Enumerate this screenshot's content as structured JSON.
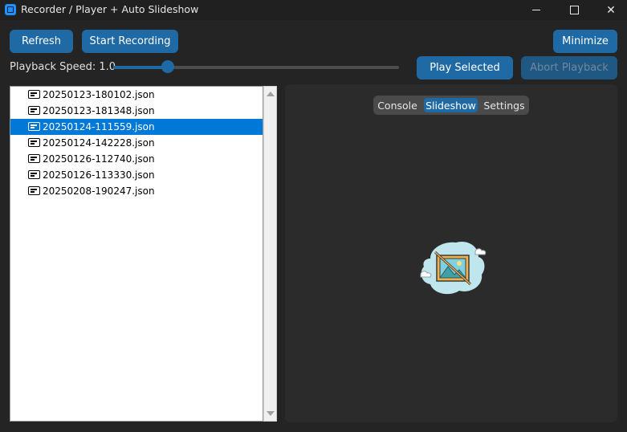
{
  "window": {
    "title": "Recorder / Player + Auto Slideshow",
    "minimize_glyph": "",
    "maximize_glyph": "",
    "close_glyph": "✕"
  },
  "toolbar": {
    "refresh_label": "Refresh",
    "start_recording_label": "Start Recording",
    "minimize_label": "Minimize",
    "play_selected_label": "Play Selected",
    "abort_playback_label": "Abort Playback",
    "abort_playback_disabled": true
  },
  "playback": {
    "speed_label": "Playback Speed: 1.0",
    "speed_value": 1.0,
    "slider_fraction": 0.19
  },
  "files": {
    "items": [
      "20250123-180102.json",
      "20250123-181348.json",
      "20250124-111559.json",
      "20250124-142228.json",
      "20250126-112740.json",
      "20250126-113330.json",
      "20250208-190247.json"
    ],
    "selected_index": 2
  },
  "tabs": {
    "console_label": "Console",
    "slideshow_label": "Slideshow",
    "settings_label": "Settings",
    "active": "Slideshow"
  },
  "slideshow": {
    "placeholder_icon": "no-image-icon"
  },
  "colors": {
    "accent": "#1f6aa5",
    "selection": "#0078d7",
    "background": "#242424",
    "panel": "#2b2b2b"
  }
}
